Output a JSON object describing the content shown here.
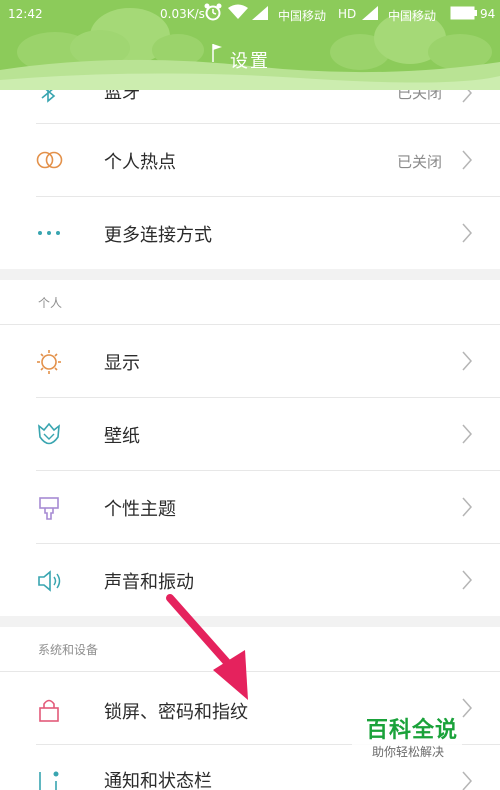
{
  "status_bar": {
    "time": "12:42",
    "net_speed": "0.03K/s",
    "carrier1": "中国移动",
    "hd": "HD",
    "carrier2": "中国移动",
    "battery": "94"
  },
  "header": {
    "title": "设置"
  },
  "items_top": [
    {
      "label": "蓝牙",
      "value": "已关闭",
      "icon": "bluetooth-icon"
    },
    {
      "label": "个人热点",
      "value": "已关闭",
      "icon": "hotspot-rings-icon"
    },
    {
      "label": "更多连接方式",
      "value": "",
      "icon": "more-dots-icon"
    }
  ],
  "section_personal": {
    "title": "个人",
    "items": [
      {
        "label": "显示",
        "icon": "sun-icon"
      },
      {
        "label": "壁纸",
        "icon": "tulip-icon"
      },
      {
        "label": "个性主题",
        "icon": "paint-brush-icon"
      },
      {
        "label": "声音和振动",
        "icon": "speaker-icon"
      }
    ]
  },
  "section_system": {
    "title": "系统和设备",
    "items": [
      {
        "label": "锁屏、密码和指纹",
        "icon": "lock-icon"
      },
      {
        "label": "通知和状态栏",
        "icon": "notification-icon"
      }
    ]
  },
  "watermark": {
    "title": "百科全说",
    "subtitle": "助你轻松解决"
  },
  "colors": {
    "header_green": "#8ccb5a",
    "orange": "#e3914a",
    "teal": "#39a5b0",
    "purple": "#a78bd3",
    "pink": "#e35a7a",
    "arrow": "#e5225d",
    "watermark_green": "#1aa23a"
  }
}
